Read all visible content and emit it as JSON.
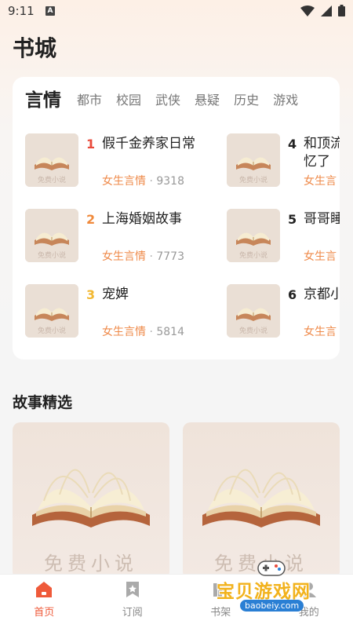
{
  "status": {
    "time": "9:11"
  },
  "page": {
    "title": "书城"
  },
  "tabs": [
    "言情",
    "都市",
    "校园",
    "武侠",
    "悬疑",
    "历史",
    "游戏"
  ],
  "books": [
    {
      "rank": "1",
      "title": "假千金养家日常",
      "title2": "",
      "category": "女生言情",
      "count": "9318",
      "rank_color": "#e94b3c"
    },
    {
      "rank": "2",
      "title": "上海婚姻故事",
      "title2": "",
      "category": "女生言情",
      "count": "7773",
      "rank_color": "#f08a3c"
    },
    {
      "rank": "3",
      "title": "宠婢",
      "title2": "",
      "category": "女生言情",
      "count": "5814",
      "rank_color": "#f2b832"
    },
    {
      "rank": "4",
      "title": "和顶流",
      "title2": "忆了",
      "category": "女生言",
      "count": "",
      "rank_color": "#222222"
    },
    {
      "rank": "5",
      "title": "哥哥睡",
      "title2": "",
      "category": "女生言",
      "count": "",
      "rank_color": "#222222"
    },
    {
      "rank": "6",
      "title": "京都小",
      "title2": "",
      "category": "女生言",
      "count": "",
      "rank_color": "#222222"
    }
  ],
  "cover_text": "免费小说",
  "section": {
    "title": "故事精选"
  },
  "tabbar": [
    {
      "label": "首页",
      "icon": "home-icon",
      "active": true
    },
    {
      "label": "订阅",
      "icon": "bookmark-star-icon",
      "active": false
    },
    {
      "label": "书架",
      "icon": "bookshelf-icon",
      "active": false
    },
    {
      "label": "我的",
      "icon": "user-icon",
      "active": false
    }
  ],
  "watermark": {
    "text": "宝贝游戏网",
    "url": "baobeiy.com"
  },
  "colors": {
    "accent": "#ef5a3a",
    "meta": "#ef8a4a"
  }
}
